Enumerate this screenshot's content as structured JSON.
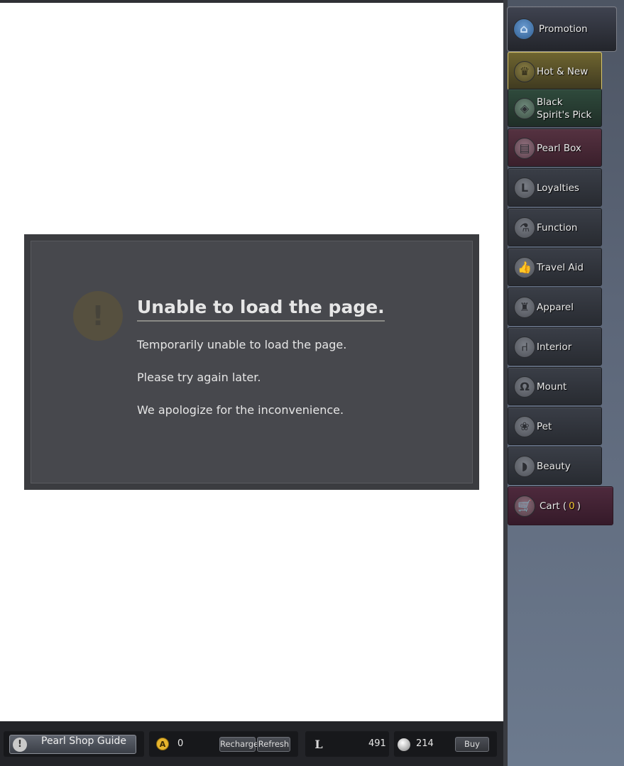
{
  "error": {
    "icon": "exclamation-icon",
    "icon_glyph": "!",
    "title": "Unable to load the page.",
    "lines": [
      "Temporarily unable to load the page.",
      "Please try again later.",
      "We apologize for the inconvenience."
    ]
  },
  "sidebar": {
    "items": [
      {
        "label": "Promotion",
        "icon": "home-icon",
        "glyph": "⌂"
      },
      {
        "label": "Hot & New",
        "icon": "trophy-icon",
        "glyph": "♛"
      },
      {
        "label": "Black Spirit's Pick",
        "icon": "diamond-icon",
        "glyph": "◈"
      },
      {
        "label": "Pearl Box",
        "icon": "box-icon",
        "glyph": "▤"
      },
      {
        "label": "Loyalties",
        "icon": "loyalty-icon",
        "glyph": "L"
      },
      {
        "label": "Function",
        "icon": "flask-icon",
        "glyph": "⚗"
      },
      {
        "label": "Travel Aid",
        "icon": "thumbs-up-icon",
        "glyph": "👍"
      },
      {
        "label": "Apparel",
        "icon": "jacket-icon",
        "glyph": "♜"
      },
      {
        "label": "Interior",
        "icon": "chair-icon",
        "glyph": "⑁"
      },
      {
        "label": "Mount",
        "icon": "horseshoe-icon",
        "glyph": "Ω"
      },
      {
        "label": "Pet",
        "icon": "paw-icon",
        "glyph": "❀"
      },
      {
        "label": "Beauty",
        "icon": "hair-icon",
        "glyph": "◗"
      }
    ],
    "cart": {
      "label": "Cart (",
      "count": "0",
      "suffix": ")",
      "icon": "cart-icon",
      "glyph": "🛒"
    }
  },
  "bottombar": {
    "guide_label": "Pearl Shop Guide",
    "guide_icon_glyph": "!",
    "acoin_glyph": "A",
    "acoin_value": "0",
    "recharge_label": "Recharge",
    "refresh_label": "Refresh",
    "loyalty_glyph": "L",
    "loyalty_value": "491",
    "silver_value": "214",
    "buy_label": "Buy"
  }
}
